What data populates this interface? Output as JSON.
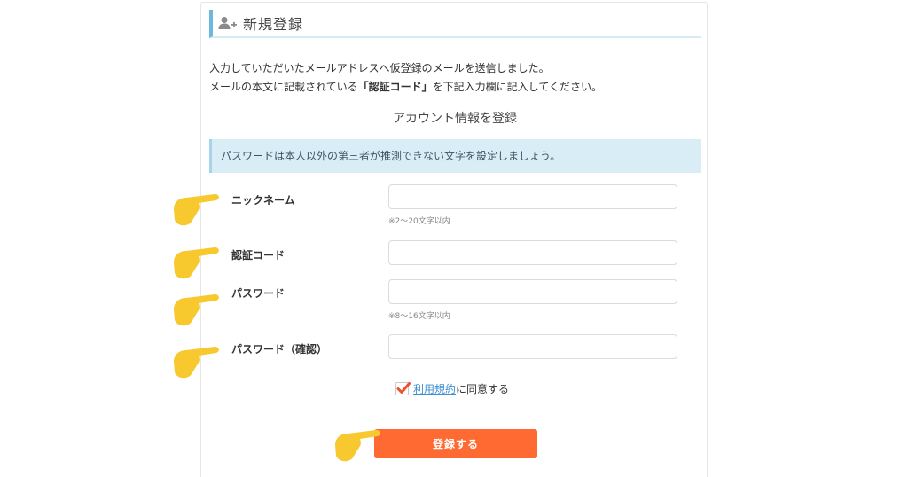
{
  "header": {
    "title": "新規登録",
    "icon": "add-user-icon"
  },
  "intro": {
    "line1": "入力していただいたメールアドレスへ仮登録のメールを送信しました。",
    "line2_pre": "メールの本文に記載されている",
    "line2_bold": "「認証コード」",
    "line2_post": "を下記入力欄に記入してください。"
  },
  "section_title": "アカウント情報を登録",
  "notice": "パスワードは本人以外の第三者が推測できない文字を設定しましょう。",
  "fields": {
    "nickname": {
      "label": "ニックネーム",
      "value": "",
      "hint": "※2～20文字以内"
    },
    "auth_code": {
      "label": "認証コード",
      "value": ""
    },
    "password": {
      "label": "パスワード",
      "value": "",
      "hint": "※8～16文字以内"
    },
    "password_confirm": {
      "label": "パスワード（確認）",
      "value": ""
    }
  },
  "agree": {
    "checked": true,
    "link_text": "利用規約",
    "suffix": "に同意する"
  },
  "submit_label": "登録する",
  "colors": {
    "accent_blue": "#6bb9dc",
    "notice_bg": "#d9edf6",
    "submit_orange": "#ff6a33",
    "check_red": "#e8542c",
    "hand_yellow": "#f8c92e",
    "link_blue": "#3f8fd2"
  },
  "icons": [
    "add-user-icon",
    "checkmark-icon",
    "pointing-hand-icon"
  ]
}
